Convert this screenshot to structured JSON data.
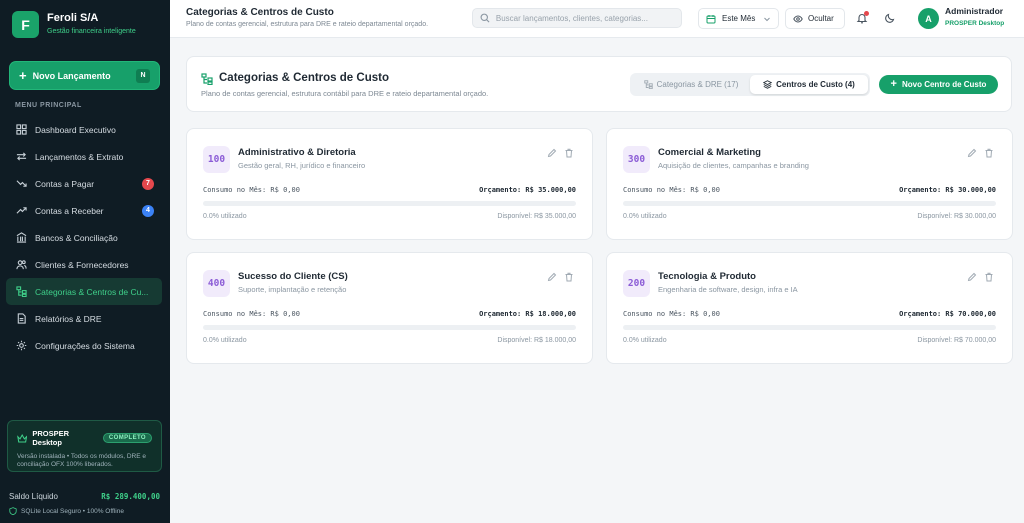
{
  "brand": {
    "name": "Feroli S/A",
    "subtitle": "Gestão financeira inteligente",
    "logo_letter": "F"
  },
  "sidebar": {
    "new_button": {
      "label": "Novo Lançamento",
      "shortcut": "N"
    },
    "menu_title": "MENU PRINCIPAL",
    "items": [
      {
        "label": "Dashboard Executivo",
        "icon": "dashboard-icon"
      },
      {
        "label": "Lançamentos & Extrato",
        "icon": "arrows-swap-icon"
      },
      {
        "label": "Contas a Pagar",
        "icon": "trend-down-icon",
        "badge": "7",
        "badge_color": "#e5484d"
      },
      {
        "label": "Contas a Receber",
        "icon": "trend-up-icon",
        "badge": "4",
        "badge_color": "#3b82f6"
      },
      {
        "label": "Bancos & Conciliação",
        "icon": "bank-icon"
      },
      {
        "label": "Clientes & Fornecedores",
        "icon": "users-icon"
      },
      {
        "label": "Categorias & Centros de Cu...",
        "icon": "tree-icon",
        "active": true
      },
      {
        "label": "Relatórios & DRE",
        "icon": "report-icon"
      },
      {
        "label": "Configurações do Sistema",
        "icon": "gear-icon"
      }
    ],
    "prosper": {
      "name": "PROSPER Desktop",
      "tag": "COMPLETO",
      "description": "Versão instalada • Todos os módulos, DRE e conciliação OFX 100% liberados."
    },
    "balance": {
      "label": "Saldo Líquido",
      "value": "R$ 289.400,00"
    },
    "offline": "SQLite Local Seguro • 100% Offline"
  },
  "topbar": {
    "title": "Categorias & Centros de Custo",
    "subtitle": "Plano de contas gerencial, estrutura para DRE e rateio departamental orçado.",
    "search_placeholder": "Buscar lançamentos, clientes, categorias...",
    "period": "Este Mês",
    "hide_label": "Ocultar",
    "user": {
      "initial": "A",
      "name": "Administrador",
      "role": "PROSPER Desktop"
    }
  },
  "header": {
    "title": "Categorias & Centros de Custo",
    "subtitle": "Plano de contas gerencial, estrutura contábil para DRE e rateio departamental orçado.",
    "tabs": [
      {
        "label": "Categorias & DRE (17)",
        "active": false
      },
      {
        "label": "Centros de Custo (4)",
        "active": true
      }
    ],
    "new_button": "Novo Centro de Custo"
  },
  "cost_centers": [
    {
      "code": "100",
      "name": "Administrativo & Diretoria",
      "description": "Gestão geral, RH, jurídico e financeiro",
      "consumo": "Consumo no Mês: R$ 0,00",
      "orcamento": "Orçamento: R$ 35.000,00",
      "used_fraction": 0.0,
      "used_label": "0.0% utilizado",
      "available": "Disponível: R$ 35.000,00"
    },
    {
      "code": "300",
      "name": "Comercial & Marketing",
      "description": "Aquisição de clientes, campanhas e branding",
      "consumo": "Consumo no Mês: R$ 0,00",
      "orcamento": "Orçamento: R$ 30.000,00",
      "used_fraction": 0.0,
      "used_label": "0.0% utilizado",
      "available": "Disponível: R$ 30.000,00"
    },
    {
      "code": "400",
      "name": "Sucesso do Cliente (CS)",
      "description": "Suporte, implantação e retenção",
      "consumo": "Consumo no Mês: R$ 0,00",
      "orcamento": "Orçamento: R$ 18.000,00",
      "used_fraction": 0.0,
      "used_label": "0.0% utilizado",
      "available": "Disponível: R$ 18.000,00"
    },
    {
      "code": "200",
      "name": "Tecnologia & Produto",
      "description": "Engenharia de software, design, infra e IA",
      "consumo": "Consumo no Mês: R$ 0,00",
      "orcamento": "Orçamento: R$ 70.000,00",
      "used_fraction": 0.0,
      "used_label": "0.0% utilizado",
      "available": "Disponível: R$ 70.000,00"
    }
  ]
}
